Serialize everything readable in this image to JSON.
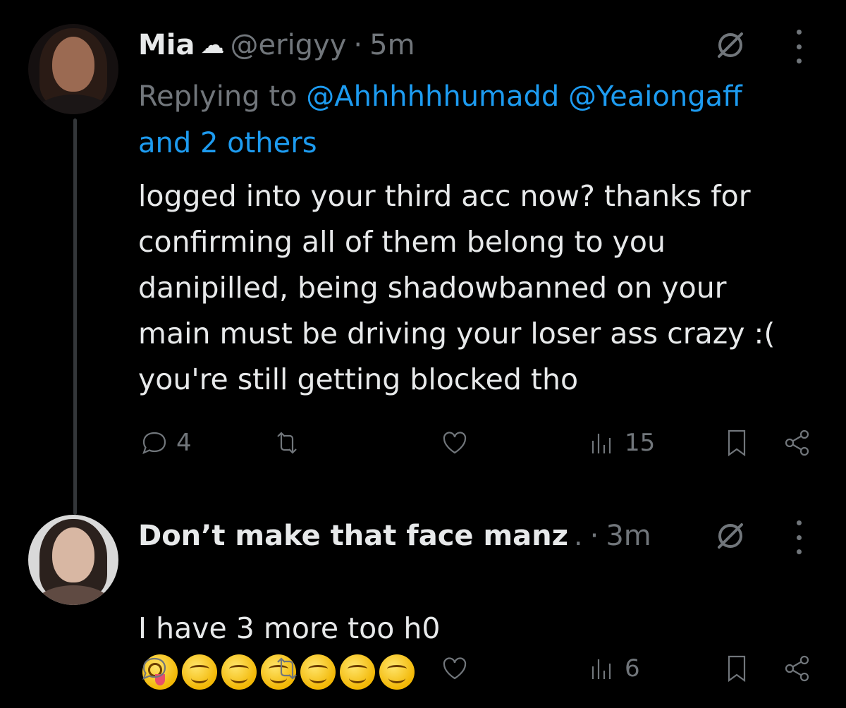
{
  "thread": {
    "tweets": [
      {
        "name": "Mia",
        "handle": "@erigyy",
        "separator": "·",
        "time": "5m",
        "badge_icon": "cloud-icon",
        "replying_prefix": "Replying to",
        "replying_mentions": "@Ahhhhhhumadd @Yeaiongaff",
        "replying_suffix": "and 2 others",
        "text": "logged into your third acc now? thanks for\nconfirming all of them belong to you\ndanipilled, being shadowbanned on your\nmain must be driving your loser ass crazy :(\nyou're still getting blocked tho",
        "replies": "4",
        "retweets": "",
        "likes": "",
        "views": "15"
      },
      {
        "name": "Don’t make that face manz",
        "name_suffix": ".",
        "separator": "·",
        "time": "3m",
        "text": "I have 3 more too h0",
        "emojis": [
          "zany-face",
          "smiling-face",
          "smiling-face",
          "smiling-face",
          "smiling-face",
          "smiling-face",
          "smiling-face"
        ],
        "replies": "",
        "retweets": "",
        "likes": "",
        "views": "6"
      }
    ]
  },
  "colors": {
    "background": "#000000",
    "text": "#e7e9ea",
    "muted": "#71767b",
    "link": "#1d9bf0",
    "thread_line": "#333639"
  }
}
